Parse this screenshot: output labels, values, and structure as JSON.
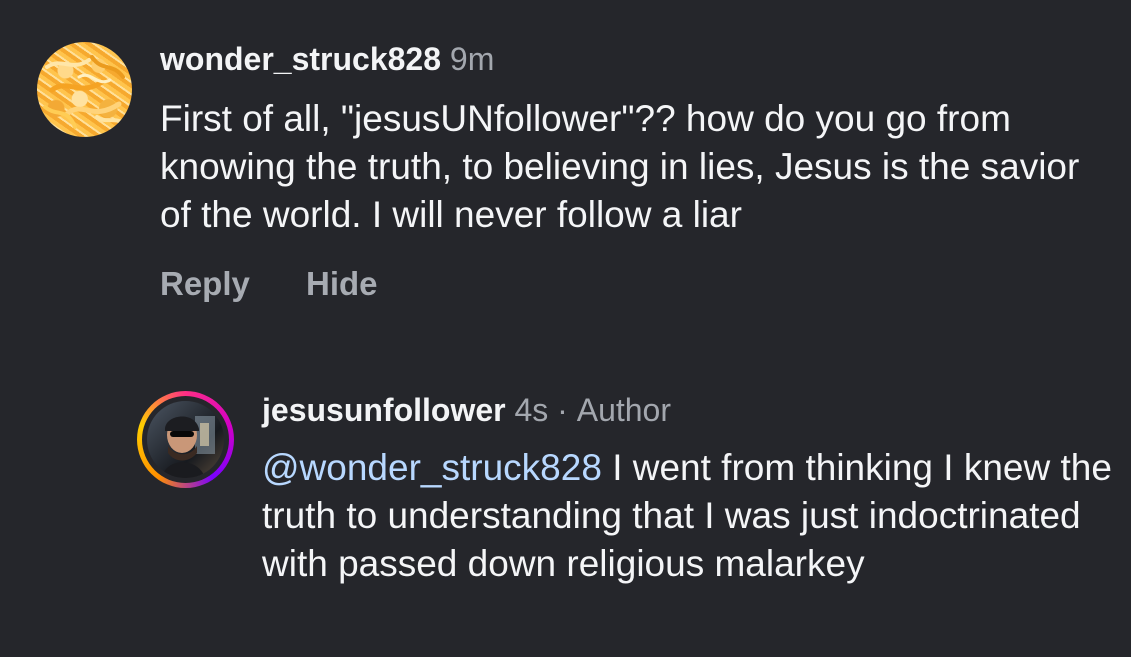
{
  "comments": [
    {
      "username": "wonder_struck828",
      "time": "9m",
      "text": "First of all, \"jesusUNfollower\"?? how do you go from knowing the truth, to believing in lies, Jesus is the savior of the world. I will never follow a liar",
      "actions": {
        "reply": "Reply",
        "hide": "Hide"
      }
    },
    {
      "username": "jesusunfollower",
      "time": "4s",
      "separator": "·",
      "role": "Author",
      "mention": "@wonder_struck828",
      "text": "I went from thinking I knew the truth to understanding that I was just indoctrinated with passed down religious malarkey"
    }
  ]
}
